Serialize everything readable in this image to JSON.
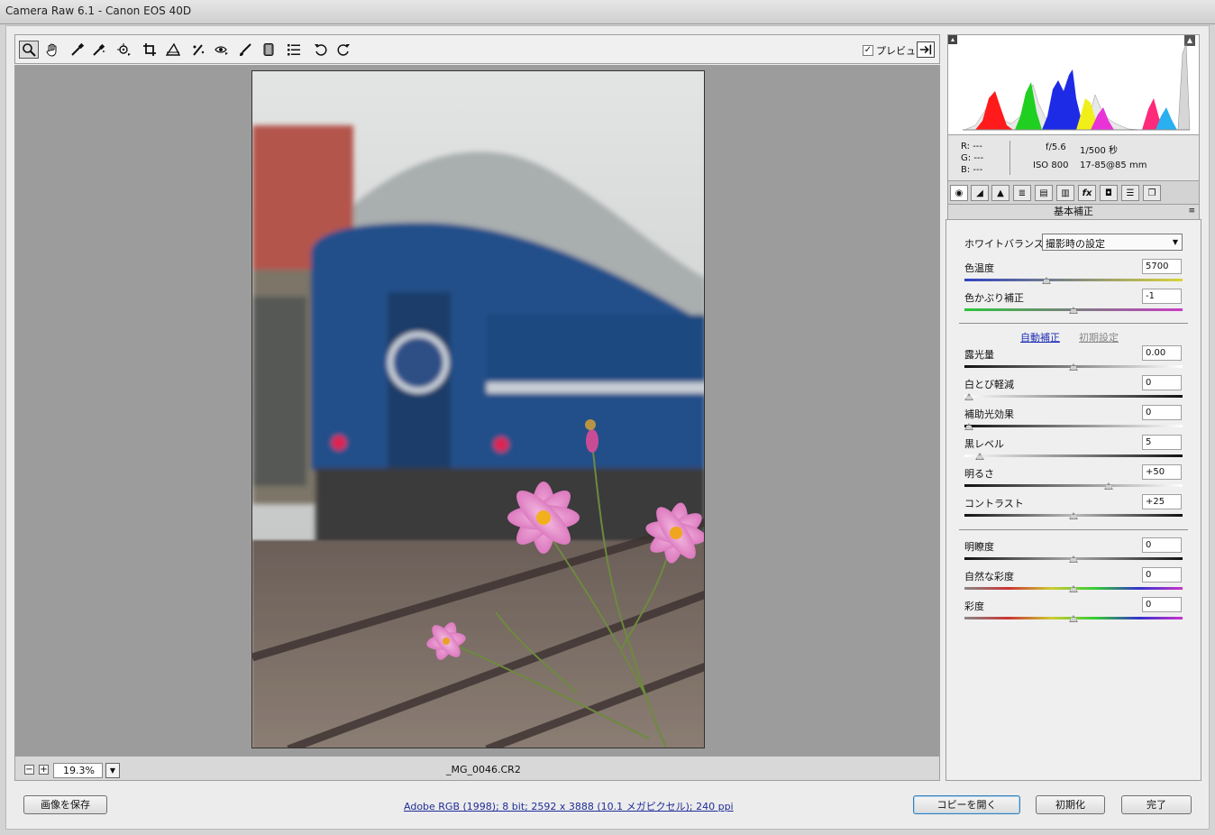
{
  "window": {
    "title": "Camera Raw 6.1  -  Canon EOS 40D"
  },
  "toolbar": {
    "tools": [
      "zoom-icon",
      "hand-icon",
      "white-balance-icon",
      "color-sampler-icon",
      "target-adjust-icon",
      "crop-icon",
      "straighten-icon",
      "spot-removal-icon",
      "red-eye-icon",
      "adjustment-brush-icon",
      "graduated-filter-icon",
      "preferences-icon",
      "rotate-ccw-icon",
      "rotate-cw-icon"
    ],
    "preview_label": "プレビュー",
    "preview_checked": true
  },
  "status": {
    "zoom": "19.3%",
    "filename": "_MG_0046.CR2"
  },
  "info": {
    "r_label": "R:",
    "r_val": "---",
    "g_label": "G:",
    "g_val": "---",
    "b_label": "B:",
    "b_val": "---",
    "aperture": "f/5.6",
    "shutter": "1/500 秒",
    "iso": "ISO 800",
    "lens": "17-85@85 mm"
  },
  "panel": {
    "title": "基本補正",
    "tabs": [
      "basic-icon",
      "tone-curve-icon",
      "detail-icon",
      "hsl-icon",
      "split-toning-icon",
      "lens-corrections-icon",
      "effects-icon",
      "camera-calibration-icon",
      "presets-icon",
      "snapshots-icon"
    ],
    "white_balance_label": "ホワイトバランス：",
    "white_balance_value": "撮影時の設定",
    "auto_label": "自動補正",
    "default_label": "初期設定",
    "sliders": {
      "temp": {
        "label": "色温度",
        "value": "5700",
        "pos": 0.37
      },
      "tint": {
        "label": "色かぶり補正",
        "value": "-1",
        "pos": 0.5
      },
      "exposure": {
        "label": "露光量",
        "value": "0.00",
        "pos": 0.5
      },
      "recovery": {
        "label": "白とび軽減",
        "value": "0",
        "pos": 0.0
      },
      "fill": {
        "label": "補助光効果",
        "value": "0",
        "pos": 0.0
      },
      "blacks": {
        "label": "黒レベル",
        "value": "5",
        "pos": 0.05
      },
      "brightness": {
        "label": "明るさ",
        "value": "+50",
        "pos": 0.67
      },
      "contrast": {
        "label": "コントラスト",
        "value": "+25",
        "pos": 0.5
      },
      "clarity": {
        "label": "明瞭度",
        "value": "0",
        "pos": 0.5
      },
      "vibrance": {
        "label": "自然な彩度",
        "value": "0",
        "pos": 0.5
      },
      "saturation": {
        "label": "彩度",
        "value": "0",
        "pos": 0.5
      }
    }
  },
  "bottom": {
    "save_label": "画像を保存",
    "workflow_link": "Adobe RGB (1998); 8 bit; 2592 x 3888 (10.1 メガピクセル); 240 ppi",
    "open_label": "コピーを開く",
    "reset_label": "初期化",
    "done_label": "完了"
  }
}
